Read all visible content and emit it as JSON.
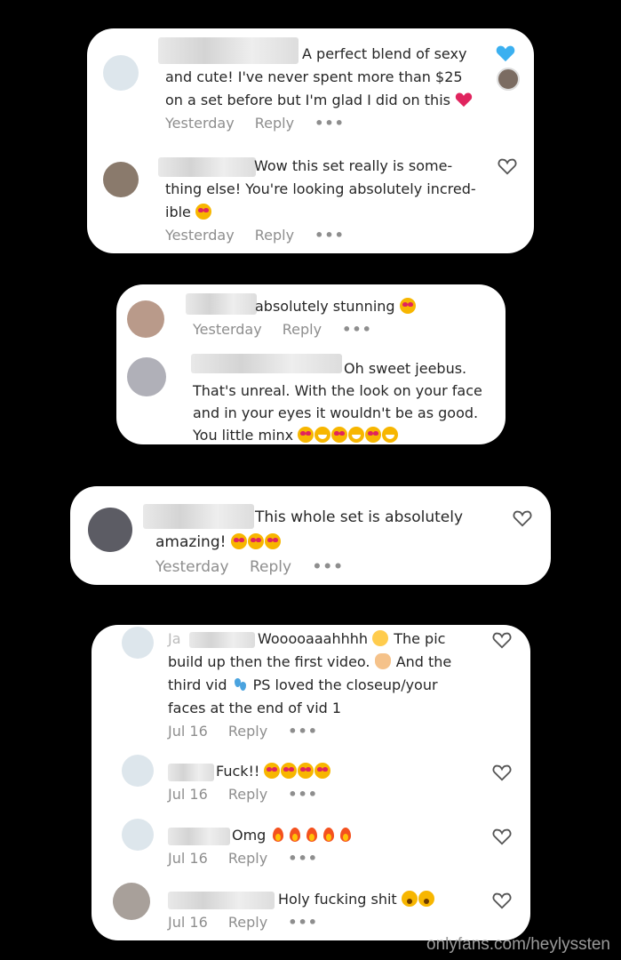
{
  "watermark": "onlyfans.com/heylyssten",
  "cards": [
    {
      "comments": [
        {
          "lines": [
            "A perfect blend of sexy",
            "and cute! I've never spent more than $25",
            "on a set before but I'm glad I did on this"
          ],
          "time": "Yesterday",
          "reply": "Reply",
          "more": "•••",
          "liked": true
        },
        {
          "lines": [
            "Wow this set really is some-",
            "thing else! You're looking absolutely incred-",
            "ible"
          ],
          "time": "Yesterday",
          "reply": "Reply",
          "more": "•••"
        }
      ]
    },
    {
      "comments": [
        {
          "lines": [
            "absolutely stunning"
          ],
          "time": "Yesterday",
          "reply": "Reply",
          "more": "•••"
        },
        {
          "lines": [
            "Oh sweet jeebus.",
            "That's unreal. With the look on your face",
            "and in your eyes it wouldn't be as good.",
            "You little minx"
          ]
        }
      ]
    },
    {
      "comments": [
        {
          "lines": [
            "This whole set is absolutely",
            "amazing!"
          ],
          "time": "Yesterday",
          "reply": "Reply",
          "more": "•••"
        }
      ]
    },
    {
      "comments": [
        {
          "lines": [
            "Ja",
            "Wooooaaahhhh",
            "The pic",
            "build up then the first video.",
            "And the",
            "third vid",
            "PS loved the closeup/your",
            "faces at the end of vid 1"
          ],
          "time": "Jul 16",
          "reply": "Reply",
          "more": "•••"
        },
        {
          "lines": [
            "Fuck!!"
          ],
          "time": "Jul 16",
          "reply": "Reply",
          "more": "•••"
        },
        {
          "lines": [
            "Omg"
          ],
          "time": "Jul 16",
          "reply": "Reply",
          "more": "•••"
        },
        {
          "lines": [
            "Holy fucking shit"
          ],
          "time": "Jul 16",
          "reply": "Reply",
          "more": "•••"
        }
      ]
    }
  ]
}
